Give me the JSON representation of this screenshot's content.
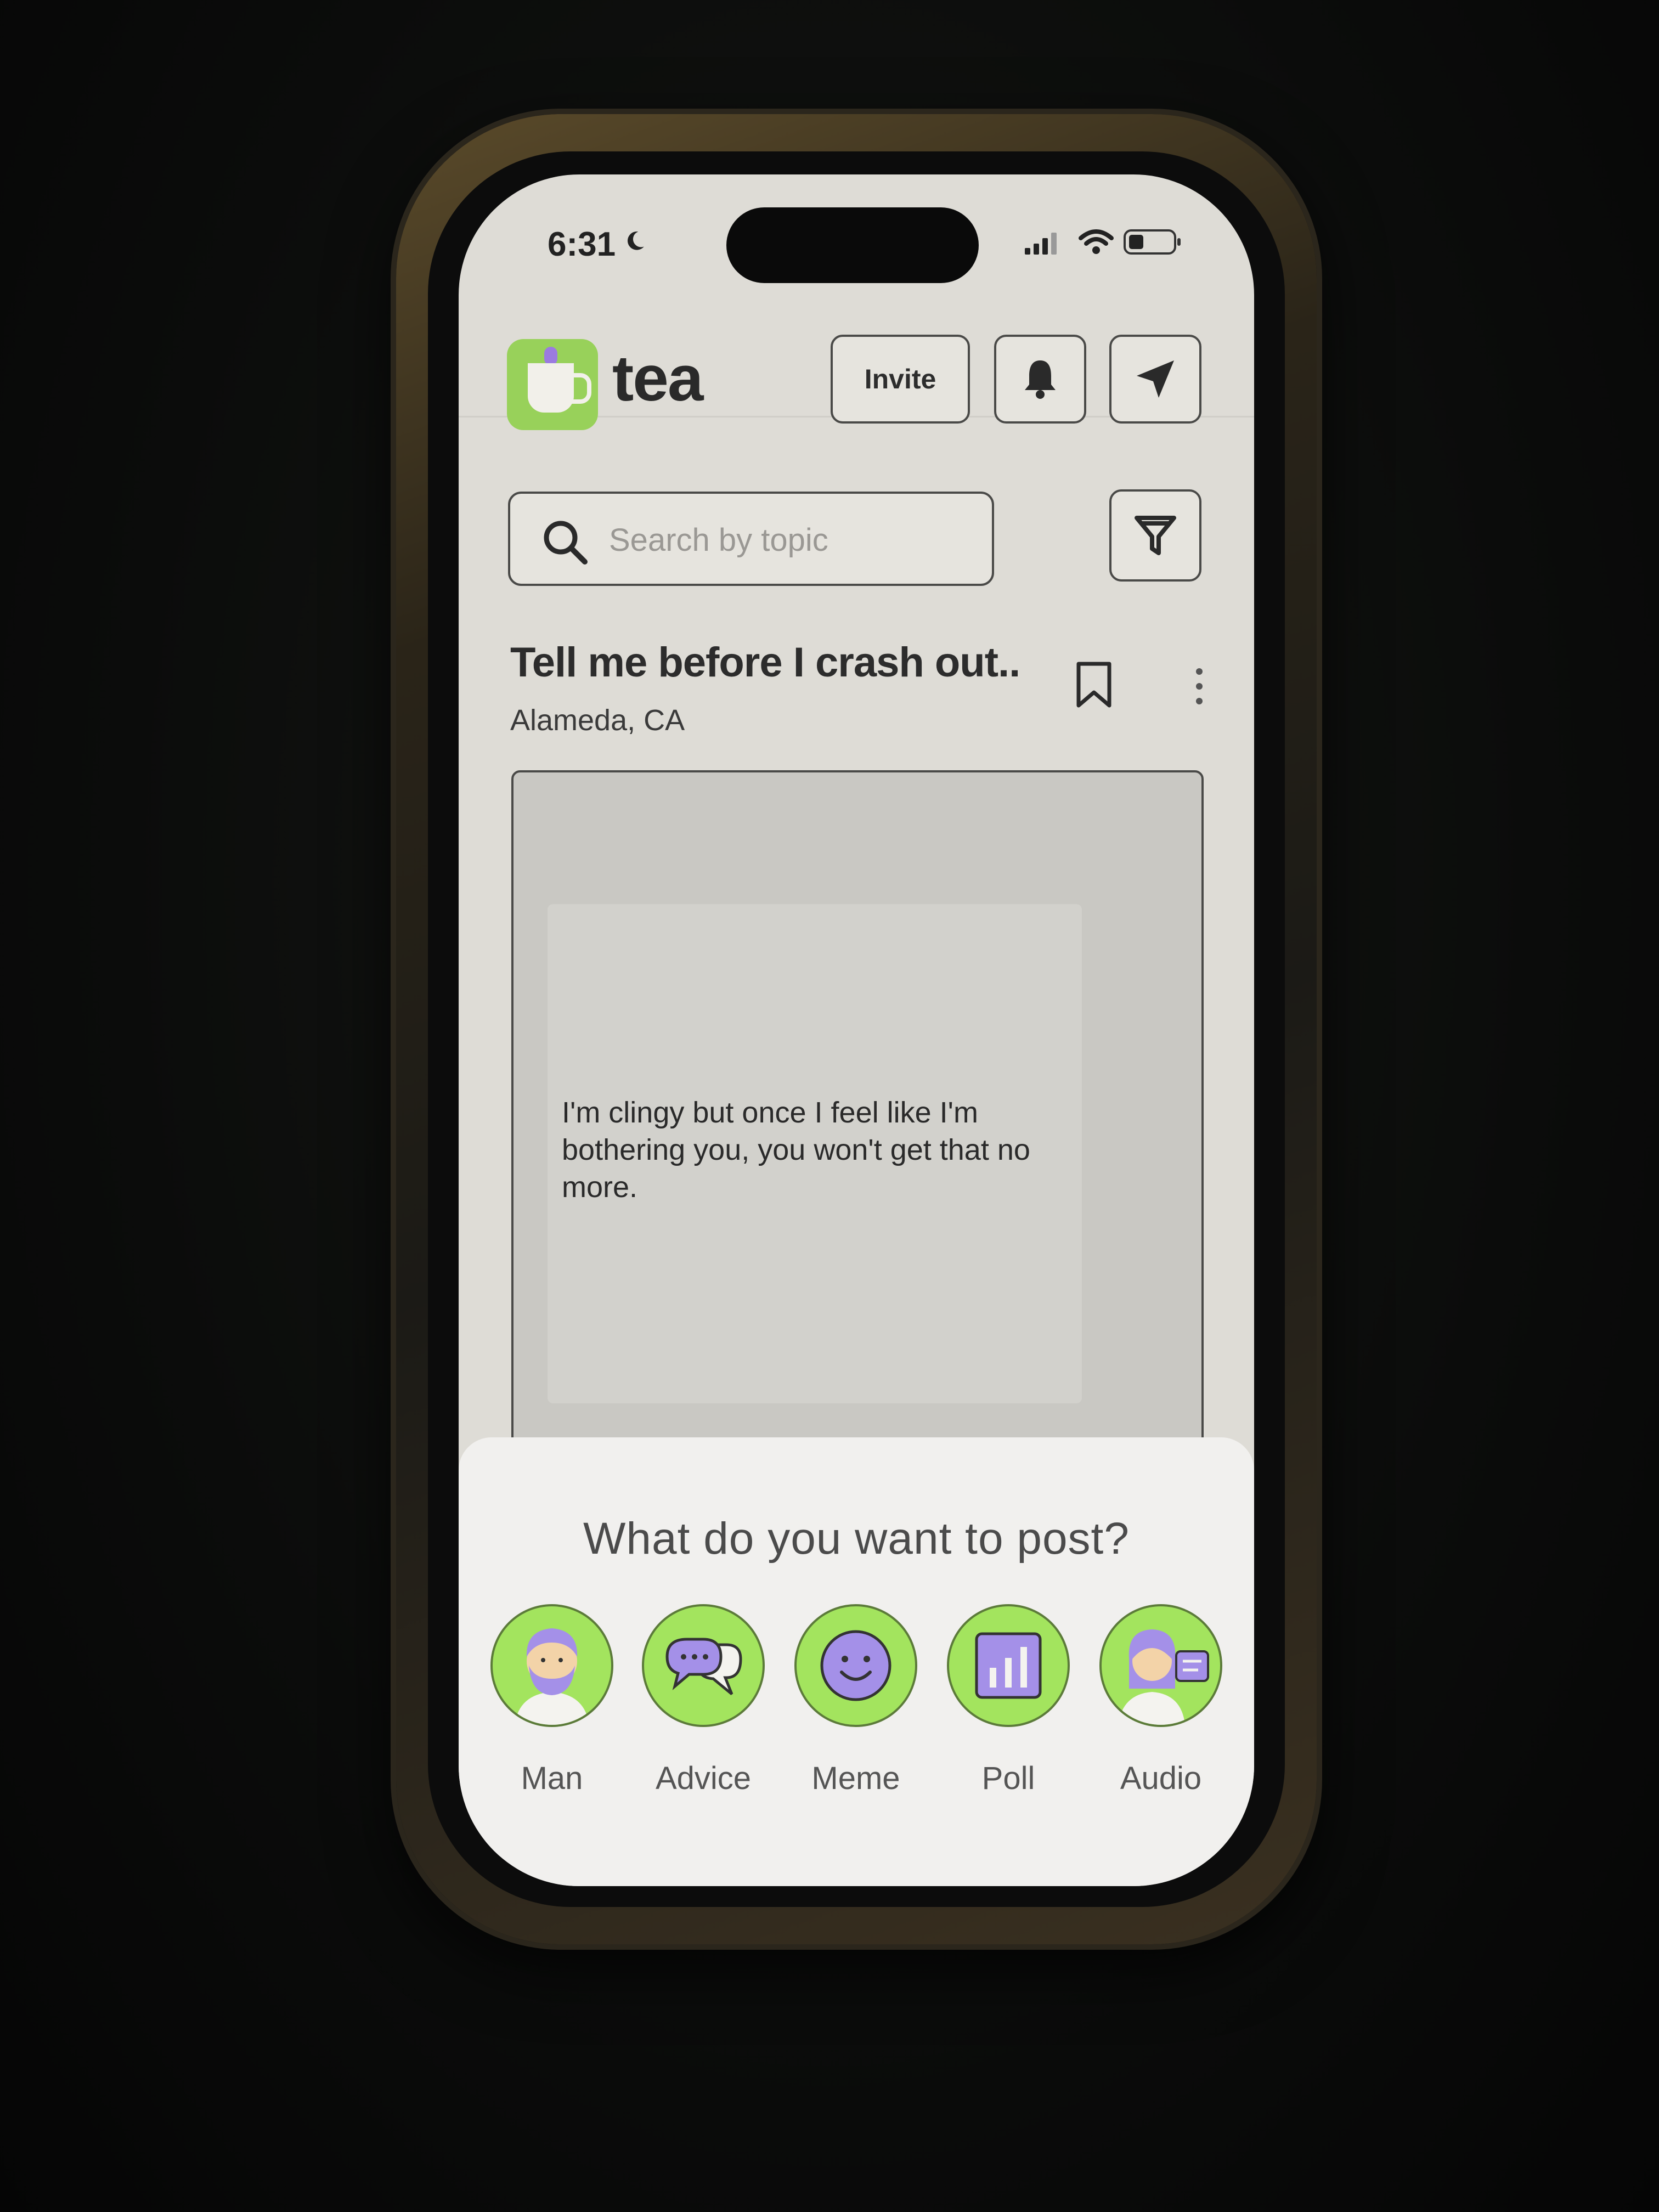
{
  "status_bar": {
    "time": "6:31"
  },
  "app": {
    "name": "tea"
  },
  "header": {
    "invite_label": "Invite"
  },
  "search": {
    "placeholder": "Search by topic"
  },
  "post": {
    "title": "Tell me before I crash out..",
    "location": "Alameda, CA",
    "text": "I'm clingy but once I feel like I'm bothering you, you won't get that no more."
  },
  "post_sheet": {
    "title": "What do you want to post?",
    "options": [
      {
        "label": "Man",
        "icon": "man-avatar-icon"
      },
      {
        "label": "Advice",
        "icon": "chat-bubbles-icon"
      },
      {
        "label": "Meme",
        "icon": "smiley-icon"
      },
      {
        "label": "Poll",
        "icon": "bar-chart-icon"
      },
      {
        "label": "Audio",
        "icon": "woman-audio-icon"
      }
    ]
  },
  "colors": {
    "brand_green": "#98d15a",
    "option_green": "#a3e45e",
    "accent_purple": "#9b7be0"
  }
}
